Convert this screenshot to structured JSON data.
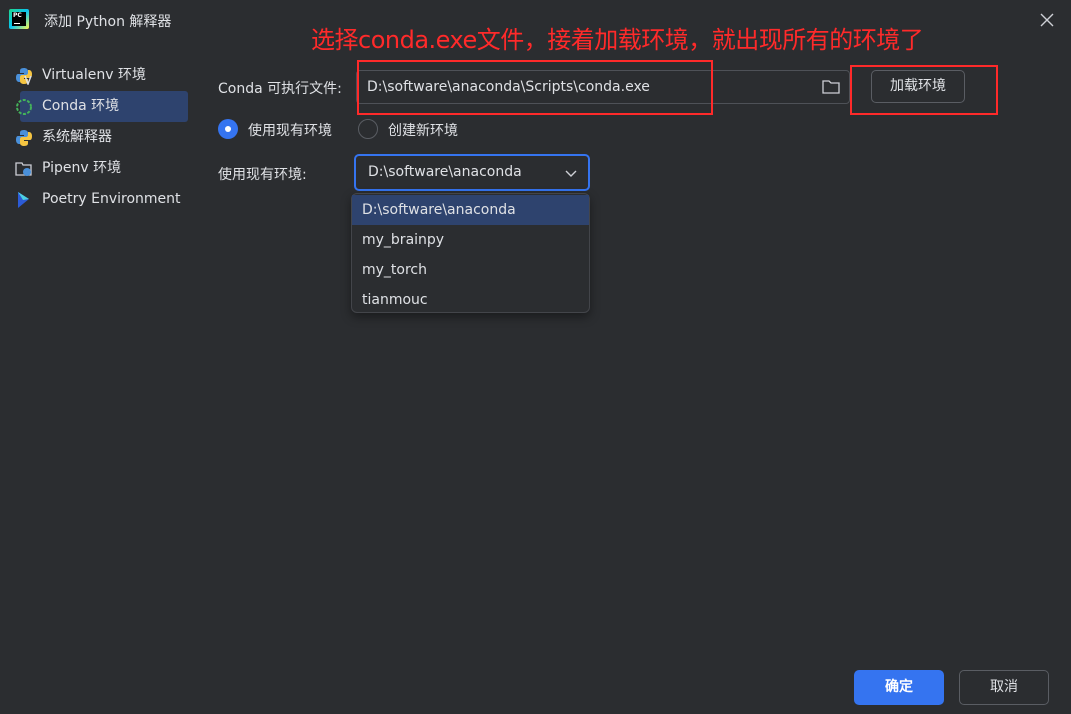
{
  "window": {
    "title": "添加 Python 解释器",
    "app_icon_text": "PC"
  },
  "annotation": {
    "text": "选择conda.exe文件，接着加载环境，就出现所有的环境了",
    "color": "#ff2a2a"
  },
  "sidebar": {
    "items": [
      {
        "label": "Virtualenv 环境",
        "icon": "virtualenv-python-icon",
        "selected": false
      },
      {
        "label": "Conda 环境",
        "icon": "conda-icon",
        "selected": true
      },
      {
        "label": "系统解释器",
        "icon": "python-icon",
        "selected": false
      },
      {
        "label": "Pipenv 环境",
        "icon": "pipenv-folder-icon",
        "selected": false
      },
      {
        "label": "Poetry Environment",
        "icon": "poetry-icon",
        "selected": false
      }
    ]
  },
  "form": {
    "conda_label": "Conda 可执行文件:",
    "conda_path": "D:\\software\\anaconda\\Scripts\\conda.exe",
    "load_button": "加载环境",
    "radio_existing": "使用现有环境",
    "radio_new": "创建新环境",
    "radio_selected": "existing",
    "existing_env_label": "使用现有环境:",
    "existing_env_value": "D:\\software\\anaconda"
  },
  "dropdown": {
    "options": [
      "D:\\software\\anaconda",
      "my_brainpy",
      "my_torch",
      "tianmouc"
    ],
    "selected_index": 0
  },
  "footer": {
    "ok_label": "确定",
    "cancel_label": "取消"
  },
  "colors": {
    "background": "#2b2d30",
    "accent": "#3574f0",
    "selection": "#2e436e",
    "text": "#dfe1e5"
  }
}
